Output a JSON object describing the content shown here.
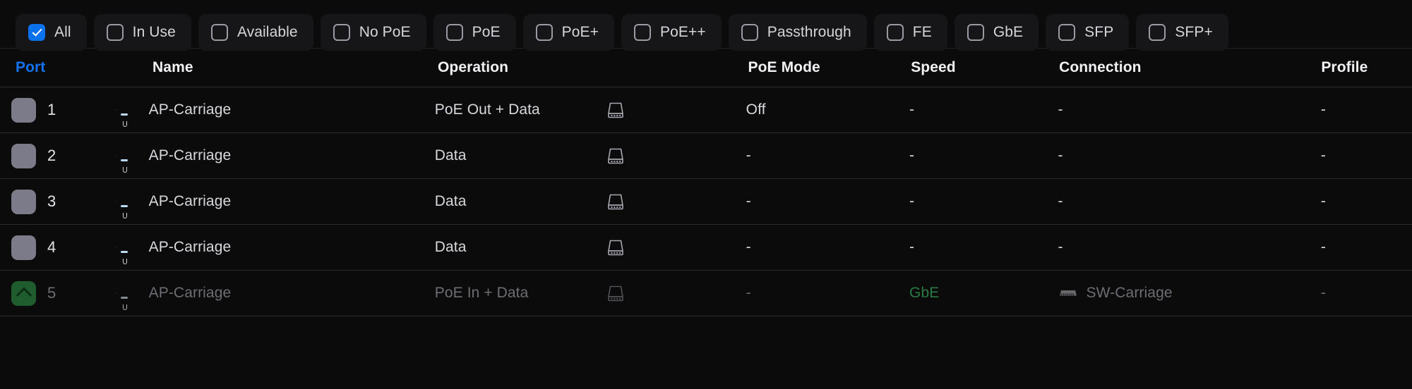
{
  "filters": {
    "chips": [
      {
        "label": "All",
        "checked": true
      },
      {
        "label": "In Use",
        "checked": false
      },
      {
        "label": "Available",
        "checked": false
      },
      {
        "label": "No PoE",
        "checked": false
      },
      {
        "label": "PoE",
        "checked": false
      },
      {
        "label": "PoE+",
        "checked": false
      },
      {
        "label": "PoE++",
        "checked": false
      },
      {
        "label": "Passthrough",
        "checked": false
      },
      {
        "label": "FE",
        "checked": false
      },
      {
        "label": "GbE",
        "checked": false
      },
      {
        "label": "SFP",
        "checked": false
      },
      {
        "label": "SFP+",
        "checked": false
      }
    ],
    "accent_checked_color": "#0b72ee"
  },
  "table": {
    "sorted_column": "Port",
    "sorted_color": "#1372f0",
    "columns": {
      "port": "Port",
      "name": "Name",
      "operation": "Operation",
      "poe_mode": "PoE Mode",
      "speed": "Speed",
      "connection": "Connection",
      "profile": "Profile"
    },
    "rows": [
      {
        "port": "1",
        "port_state": "inactive",
        "name": "AP-Carriage",
        "operation": "PoE Out + Data",
        "device_icon": "ap-device-icon",
        "poe_mode": "Off",
        "speed": "-",
        "connection": "-",
        "connection_icon": null,
        "profile": "-",
        "disabled": false
      },
      {
        "port": "2",
        "port_state": "inactive",
        "name": "AP-Carriage",
        "operation": "Data",
        "device_icon": "ap-device-icon",
        "poe_mode": "-",
        "speed": "-",
        "connection": "-",
        "connection_icon": null,
        "profile": "-",
        "disabled": false
      },
      {
        "port": "3",
        "port_state": "inactive",
        "name": "AP-Carriage",
        "operation": "Data",
        "device_icon": "ap-device-icon",
        "poe_mode": "-",
        "speed": "-",
        "connection": "-",
        "connection_icon": null,
        "profile": "-",
        "disabled": false
      },
      {
        "port": "4",
        "port_state": "inactive",
        "name": "AP-Carriage",
        "operation": "Data",
        "device_icon": "ap-device-icon",
        "poe_mode": "-",
        "speed": "-",
        "connection": "-",
        "connection_icon": null,
        "profile": "-",
        "disabled": false
      },
      {
        "port": "5",
        "port_state": "uplink",
        "name": "AP-Carriage",
        "operation": "PoE In + Data",
        "device_icon": "ap-device-icon",
        "poe_mode": "-",
        "speed": "GbE",
        "speed_color": "#2f9e4f",
        "connection": "SW-Carriage",
        "connection_icon": "switch-icon",
        "profile": "-",
        "disabled": true
      }
    ]
  }
}
